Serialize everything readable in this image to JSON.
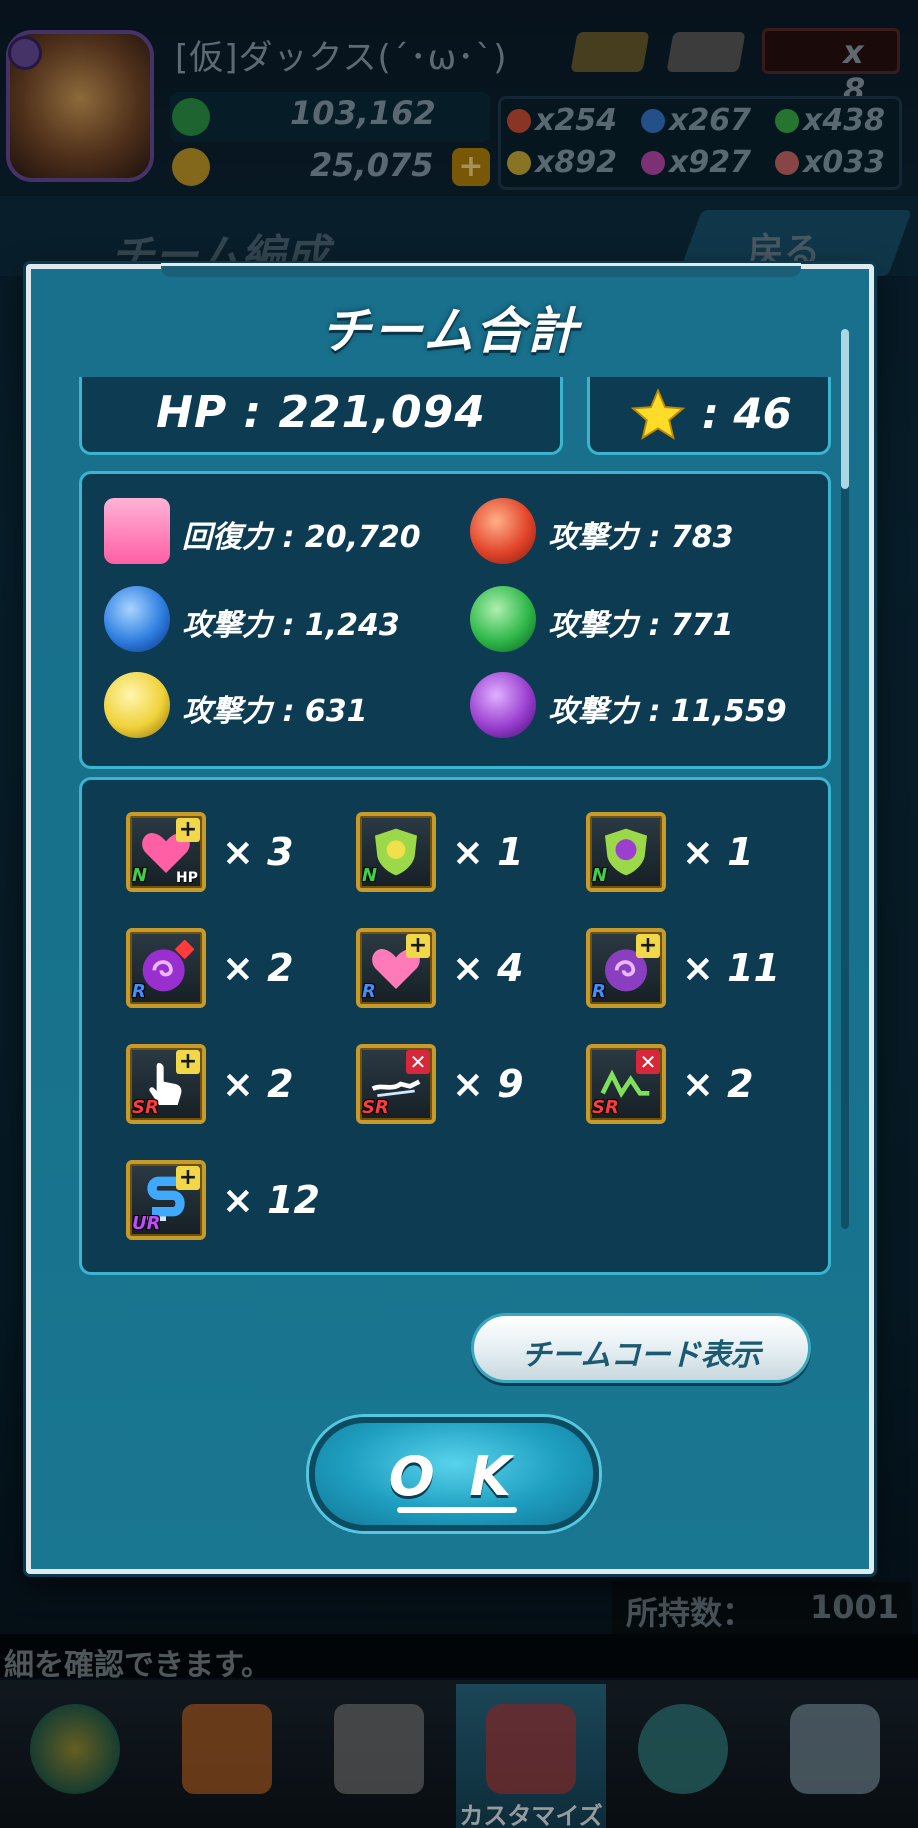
{
  "status_bar": {
    "player_name": "[仮]ダックス(´･ω･`)",
    "monster_exp": "103,162",
    "coins": "25,075",
    "coin_plus": "+",
    "tickets": "x 8",
    "orbs": [
      {
        "label": "x254",
        "color": "#d2523a"
      },
      {
        "label": "x267",
        "color": "#3a7ad2"
      },
      {
        "label": "x438",
        "color": "#3ab24a"
      },
      {
        "label": "x892",
        "color": "#d2b23a"
      },
      {
        "label": "x927",
        "color": "#c24ab2"
      },
      {
        "label": "x033",
        "color": "#d26a6a"
      }
    ]
  },
  "background": {
    "screen_title": "チーム編成",
    "back_label": "戻る",
    "owned_label": "所持数：",
    "owned_value": "1001",
    "hint": "細を確認できます。"
  },
  "modal": {
    "title": "チーム合計",
    "hp": "HP : 221,094",
    "stars": ": 46",
    "attributes": [
      {
        "name": "heal",
        "label": "回復力 : 20,720",
        "icon": "heart-icon",
        "color": "#ff6fb0"
      },
      {
        "name": "fire",
        "label": "攻撃力 : 783",
        "icon": "fire-orb-icon",
        "color": "#e2442a"
      },
      {
        "name": "water",
        "label": "攻撃力 : 1,243",
        "icon": "water-orb-icon",
        "color": "#2f7fe0"
      },
      {
        "name": "wood",
        "label": "攻撃力 : 771",
        "icon": "wood-orb-icon",
        "color": "#2fb84a"
      },
      {
        "name": "light",
        "label": "攻撃力 : 631",
        "icon": "light-orb-icon",
        "color": "#f0d23a"
      },
      {
        "name": "dark",
        "label": "攻撃力 : 11,559",
        "icon": "dark-orb-icon",
        "color": "#9a3fd0"
      }
    ],
    "abilities": [
      {
        "icon": "heart-plus-icon",
        "rank": "N",
        "rank_color": "#3fd04a",
        "badge": "plus",
        "count": "× 3",
        "sub": "HP"
      },
      {
        "icon": "light-shield-icon",
        "rank": "N",
        "rank_color": "#3fd04a",
        "badge": "none",
        "count": "× 1",
        "sub": ""
      },
      {
        "icon": "dark-shield-icon",
        "rank": "N",
        "rank_color": "#3fd04a",
        "badge": "none",
        "count": "× 1",
        "sub": ""
      },
      {
        "icon": "dark-swirl-diamond-icon",
        "rank": "R",
        "rank_color": "#3f8fff",
        "badge": "diamond",
        "count": "× 2",
        "sub": ""
      },
      {
        "icon": "heart-plus-icon",
        "rank": "R",
        "rank_color": "#3f8fff",
        "badge": "plus",
        "count": "× 4",
        "sub": ""
      },
      {
        "icon": "dark-orb-plus-icon",
        "rank": "R",
        "rank_color": "#3f8fff",
        "badge": "plus",
        "count": "× 11",
        "sub": ""
      },
      {
        "icon": "tap-hand-icon",
        "rank": "SR",
        "rank_color": "#ff3b3b",
        "badge": "plus",
        "count": "× 2",
        "sub": ""
      },
      {
        "icon": "lightning-cancel-icon",
        "rank": "SR",
        "rank_color": "#ff3b3b",
        "badge": "x",
        "count": "× 9",
        "sub": ""
      },
      {
        "icon": "terrain-cancel-icon",
        "rank": "SR",
        "rank_color": "#ff3b3b",
        "badge": "x",
        "count": "× 2",
        "sub": ""
      },
      {
        "icon": "path-plus-icon",
        "rank": "UR",
        "rank_color": "#c24aff",
        "badge": "plus",
        "count": "× 12",
        "sub": ""
      }
    ],
    "team_code_button": "チームコード表示",
    "ok_button": "O K"
  },
  "bottom_nav": [
    {
      "name": "home",
      "icon": "home-icon",
      "label": "",
      "active": false
    },
    {
      "name": "shop",
      "icon": "shop-bag-icon",
      "label": "",
      "active": false
    },
    {
      "name": "battle",
      "icon": "crossed-swords-icon",
      "label": "",
      "active": false
    },
    {
      "name": "customize",
      "icon": "customize-icon",
      "label": "カスタマイズ",
      "active": true
    },
    {
      "name": "friends",
      "icon": "friends-icon",
      "label": "",
      "active": false
    },
    {
      "name": "help",
      "icon": "question-icon",
      "label": "",
      "active": false
    }
  ]
}
